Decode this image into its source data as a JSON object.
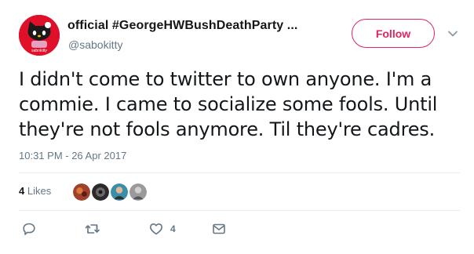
{
  "author": {
    "display_name": "official #GeorgeHWBushDeathParty ...",
    "handle": "@sabokitty",
    "avatar_icon": "hello-kitty-avatar-icon",
    "avatar_color": "#e0102b"
  },
  "follow_button": {
    "label": "Follow",
    "color": "#e0245e"
  },
  "menu": {
    "icon": "chevron-down-icon"
  },
  "tweet": {
    "lines": [
      "I didn't come to twitter to own anyone. I'm a",
      "commie. I came to socialize some fools. Until",
      "they're not fools anymore. Til they're cadres."
    ],
    "timestamp": "10:31 PM - 26 Apr 2017"
  },
  "stats": {
    "likes_count": "4",
    "likes_label": "Likes",
    "likers": [
      "liker-avatar-1",
      "liker-avatar-2",
      "liker-avatar-3",
      "liker-avatar-4"
    ]
  },
  "actions": {
    "reply": {
      "icon": "reply-icon",
      "count": ""
    },
    "retweet": {
      "icon": "retweet-icon",
      "count": ""
    },
    "like": {
      "icon": "heart-icon",
      "count": "4"
    },
    "message": {
      "icon": "envelope-icon",
      "count": ""
    }
  },
  "colors": {
    "text": "#14171a",
    "muted": "#657786",
    "accent": "#e0245e",
    "divider": "#e6ecf0"
  }
}
